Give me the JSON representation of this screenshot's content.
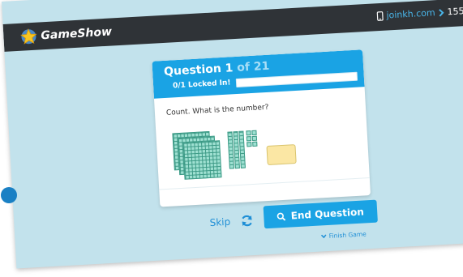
{
  "header": {
    "brand": "GameShow",
    "join_url": "joinkh.com",
    "join_code": "155"
  },
  "question": {
    "label": "Question 1",
    "count": "of 21",
    "locked": "0/1 Locked In!",
    "progress": 0,
    "prompt": "Count. What is the number?",
    "blocks": {
      "hundreds": 3,
      "tens": 3,
      "ones": 6
    }
  },
  "controls": {
    "skip": "Skip",
    "end_question": "End Question",
    "finish_game": "Finish Game"
  },
  "colors": {
    "accent": "#1aa3e4",
    "background": "#c2e2ec",
    "topbar": "#2f3337",
    "answer_box": "#fbe7a4"
  }
}
